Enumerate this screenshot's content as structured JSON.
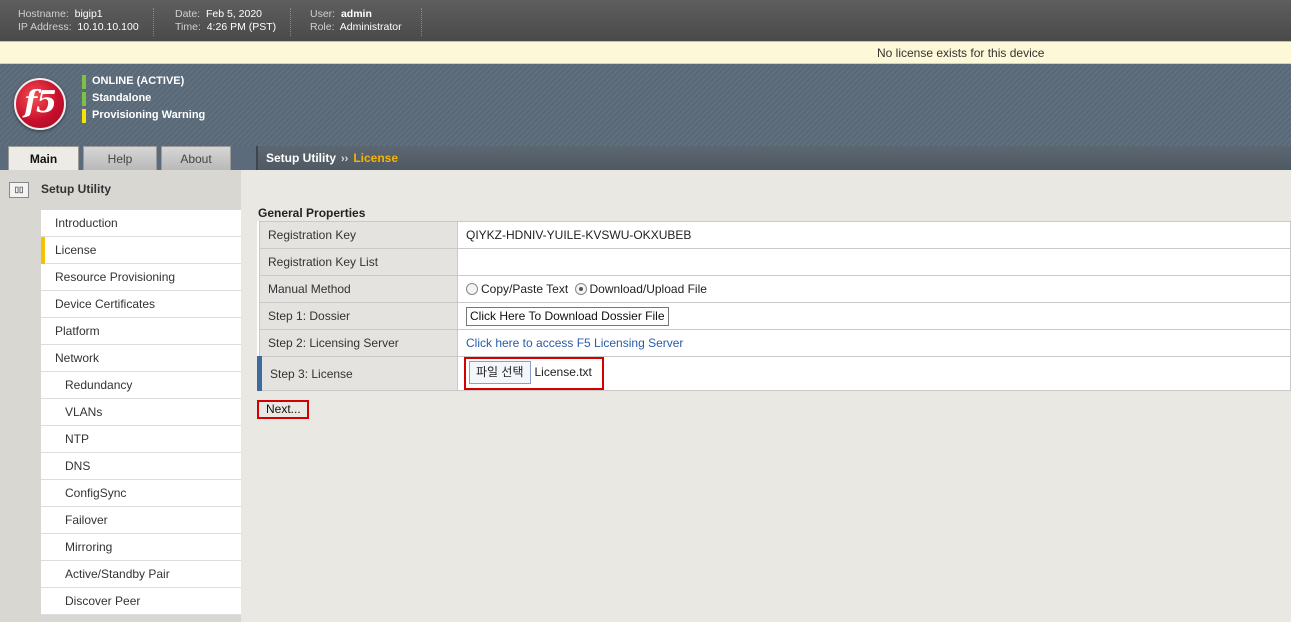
{
  "topbar": {
    "hostname_label": "Hostname:",
    "hostname": "bigip1",
    "ip_label": "IP Address:",
    "ip": "10.10.10.100",
    "date_label": "Date:",
    "date": "Feb 5, 2020",
    "time_label": "Time:",
    "time": "4:26 PM (PST)",
    "user_label": "User:",
    "user": "admin",
    "role_label": "Role:",
    "role": "Administrator"
  },
  "license_notice": "No license exists for this device",
  "banner": {
    "logo_text": "f5",
    "status": [
      {
        "text": "ONLINE (ACTIVE)",
        "color": "#7dc242"
      },
      {
        "text": "Standalone",
        "color": "#7dc242"
      },
      {
        "text": "Provisioning Warning",
        "color": "#f5e400"
      }
    ]
  },
  "tabs": [
    "Main",
    "Help",
    "About"
  ],
  "breadcrumb": {
    "parent": "Setup Utility",
    "sep": "››",
    "current": "License"
  },
  "sidebar": {
    "title": "Setup Utility",
    "items": [
      {
        "label": "Introduction"
      },
      {
        "label": "License"
      },
      {
        "label": "Resource Provisioning"
      },
      {
        "label": "Device Certificates"
      },
      {
        "label": "Platform"
      },
      {
        "label": "Network"
      },
      {
        "label": "Redundancy"
      },
      {
        "label": "VLANs"
      },
      {
        "label": "NTP"
      },
      {
        "label": "DNS"
      },
      {
        "label": "ConfigSync"
      },
      {
        "label": "Failover"
      },
      {
        "label": "Mirroring"
      },
      {
        "label": "Active/Standby Pair"
      },
      {
        "label": "Discover Peer"
      }
    ]
  },
  "main": {
    "section_title": "General Properties",
    "registration_key_label": "Registration Key",
    "registration_key": "QIYKZ-HDNIV-YUILE-KVSWU-OKXUBEB",
    "registration_key_list_label": "Registration Key List",
    "manual_method_label": "Manual Method",
    "manual_option_1": "Copy/Paste Text",
    "manual_option_2": "Download/Upload File",
    "step1_label": "Step 1: Dossier",
    "step1_button": "Click Here To Download Dossier File",
    "step2_label": "Step 2: Licensing Server",
    "step2_link": "Click here to access F5 Licensing Server",
    "step3_label": "Step 3: License",
    "file_button": "파일 선택",
    "file_name": "License.txt",
    "next_button": "Next..."
  }
}
